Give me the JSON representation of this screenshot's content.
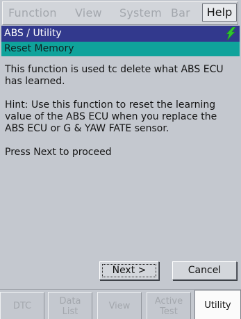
{
  "menu": {
    "items": [
      "Function",
      "View",
      "System",
      "Bar"
    ],
    "help_label": "Help"
  },
  "header": {
    "title": "ABS / Utility",
    "subtitle": "Reset Memory",
    "status_icon": "signal-bolt-icon",
    "title_bar_color": "#32398d",
    "sub_bar_color": "#0fa39b",
    "icon_color": "#2fc62f"
  },
  "content": {
    "paragraphs": [
      "This function is used tc delete what ABS ECU has learned.",
      "Hint: Use this function to reset the learning value of the ABS ECU when you replace the ABS ECU or G & YAW FATE sensor.",
      "Press Next to proceed"
    ]
  },
  "buttons": {
    "next_label": "Next >",
    "cancel_label": "Cancel"
  },
  "tabs": [
    {
      "label": "DTC"
    },
    {
      "label_line1": "Data",
      "label_line2": "List"
    },
    {
      "label": "View"
    },
    {
      "label_line1": "Active",
      "label_line2": "Test"
    },
    {
      "label": "Utility"
    }
  ],
  "selected_tab": "Utility"
}
